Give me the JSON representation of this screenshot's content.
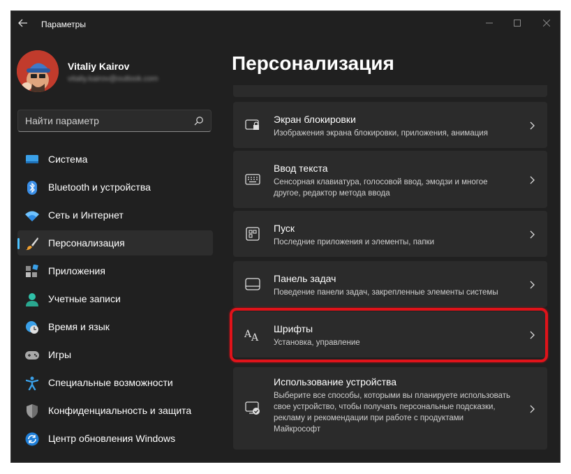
{
  "window": {
    "title": "Параметры",
    "controls": [
      "minimize",
      "maximize",
      "close"
    ]
  },
  "profile": {
    "name": "Vitaliy Kairov",
    "email": "vitaliy.kairov@outlook.com"
  },
  "search": {
    "placeholder": "Найти параметр",
    "icon": "search-icon"
  },
  "sidebar": {
    "items": [
      {
        "label": "Система",
        "icon": "monitor-icon"
      },
      {
        "label": "Bluetooth и устройства",
        "icon": "bluetooth-icon"
      },
      {
        "label": "Сеть и Интернет",
        "icon": "wifi-icon"
      },
      {
        "label": "Персонализация",
        "icon": "brush-icon",
        "selected": true
      },
      {
        "label": "Приложения",
        "icon": "apps-icon"
      },
      {
        "label": "Учетные записи",
        "icon": "account-icon"
      },
      {
        "label": "Время и язык",
        "icon": "clock-globe-icon"
      },
      {
        "label": "Игры",
        "icon": "gamepad-icon"
      },
      {
        "label": "Специальные возможности",
        "icon": "accessibility-icon"
      },
      {
        "label": "Конфиденциальность и защита",
        "icon": "shield-icon"
      },
      {
        "label": "Центр обновления Windows",
        "icon": "update-icon"
      }
    ]
  },
  "main": {
    "title": "Персонализация",
    "cards": [
      {
        "title": "Экран блокировки",
        "desc": "Изображения экрана блокировки, приложения, анимация",
        "icon": "lock-screen-icon"
      },
      {
        "title": "Ввод текста",
        "desc": "Сенсорная клавиатура, голосовой ввод, эмодзи и многое другое, редактор метода ввода",
        "icon": "keyboard-icon"
      },
      {
        "title": "Пуск",
        "desc": "Последние приложения и элементы, папки",
        "icon": "start-icon"
      },
      {
        "title": "Панель задач",
        "desc": "Поведение панели задач, закрепленные элементы системы",
        "icon": "taskbar-icon"
      },
      {
        "title": "Шрифты",
        "desc": "Установка, управление",
        "icon": "fonts-icon",
        "highlighted": true
      },
      {
        "title": "Использование устройства",
        "desc": "Выберите все способы, которыми вы планируете использовать свое устройство, чтобы получать персональные подсказки, рекламу и рекомендации при работе с продуктами Майкрософт",
        "icon": "device-usage-icon"
      }
    ]
  },
  "colors": {
    "window_bg": "#202020",
    "card_bg": "#2b2b2b",
    "accent": "#4cc2ff",
    "highlight": "#e0131a"
  }
}
